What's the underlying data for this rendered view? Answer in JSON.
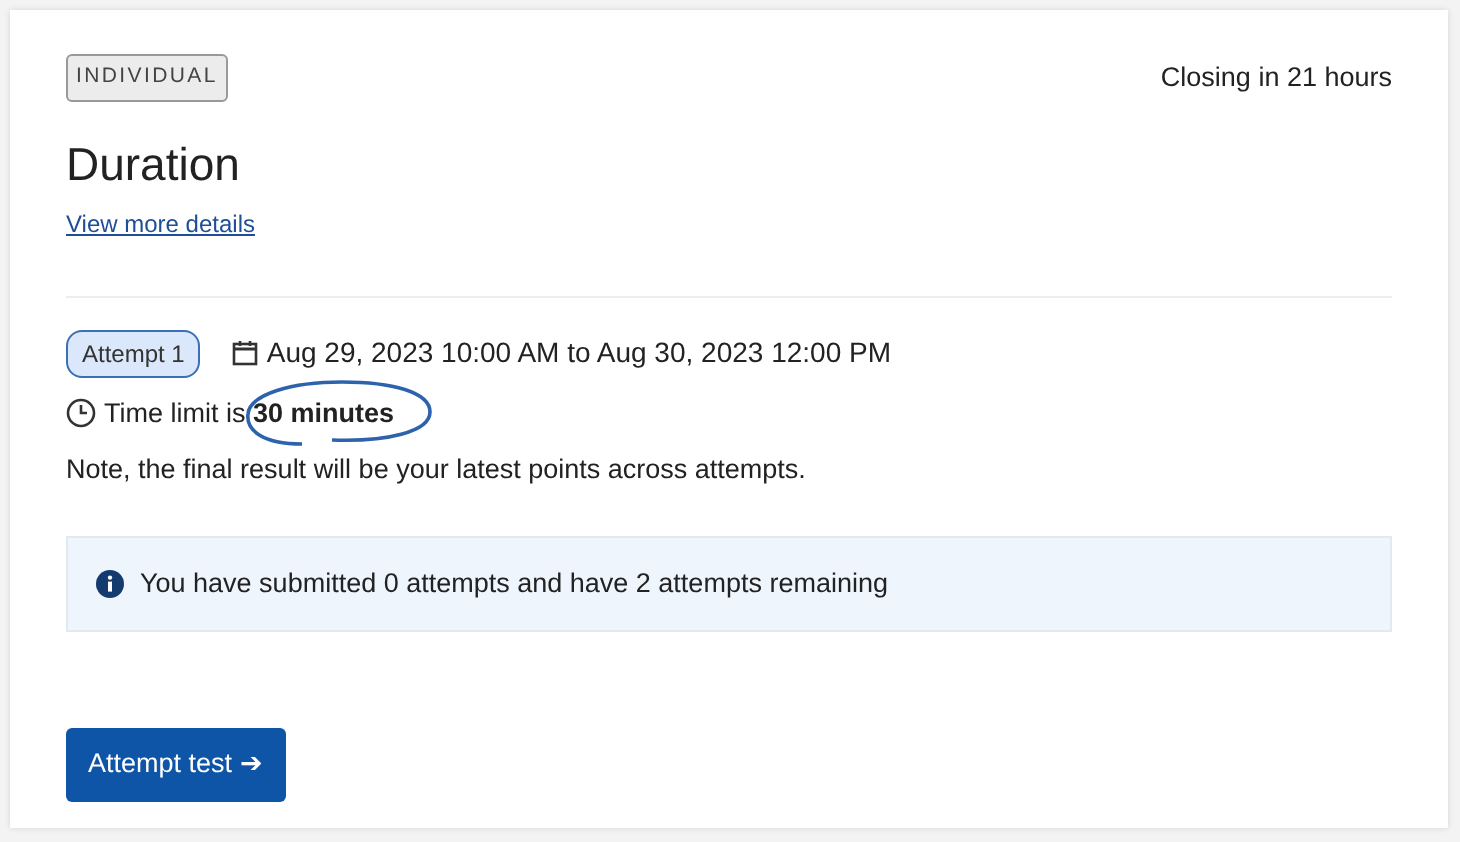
{
  "card": {
    "type_tag": "INDIVIDUAL",
    "closing": "Closing in 21 hours",
    "title": "Duration",
    "details_link": "View more details"
  },
  "attempt": {
    "badge": "Attempt 1",
    "schedule": "Aug 29, 2023 10:00 AM to Aug 30, 2023 12:00 PM",
    "time_limit": "Time limit is **30 minutes**",
    "time_limit_circled": true,
    "note": "Note, the final result will be your latest points across attempts."
  },
  "info": {
    "message": "You have submitted 0 attempts and have 2 attempts remaining"
  },
  "button": {
    "label": "Attempt test ➔"
  }
}
